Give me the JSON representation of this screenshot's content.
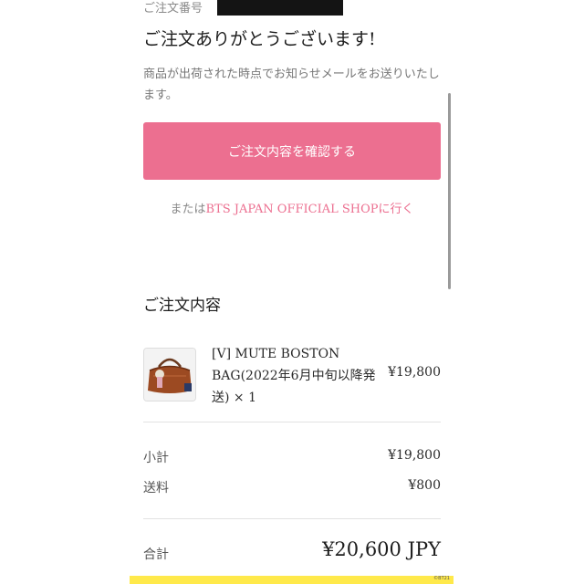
{
  "order": {
    "number_label": "ご注文番号"
  },
  "thanks": {
    "heading": "ご注文ありがとうございます!",
    "notice": "商品が出荷された時点でお知らせメールをお送りいたします。"
  },
  "actions": {
    "confirm_label": "ご注文内容を確認する",
    "shop_prefix": "または",
    "shop_link": "BTS JAPAN OFFICIAL SHOP",
    "shop_suffix": "に行く"
  },
  "order_details": {
    "title": "ご注文内容",
    "items": [
      {
        "name": "[V] MUTE BOSTON BAG(2022年6月中旬以降発送) × 1",
        "price": "¥19,800"
      }
    ]
  },
  "summary": {
    "subtotal_label": "小計",
    "subtotal_value": "¥19,800",
    "shipping_label": "送料",
    "shipping_value": "¥800",
    "total_label": "合計",
    "total_value": "¥20,600 JPY"
  },
  "footer": {
    "tag": "©BT21"
  },
  "colors": {
    "accent": "#ec6f90",
    "footer_bar": "#ffe94a"
  }
}
